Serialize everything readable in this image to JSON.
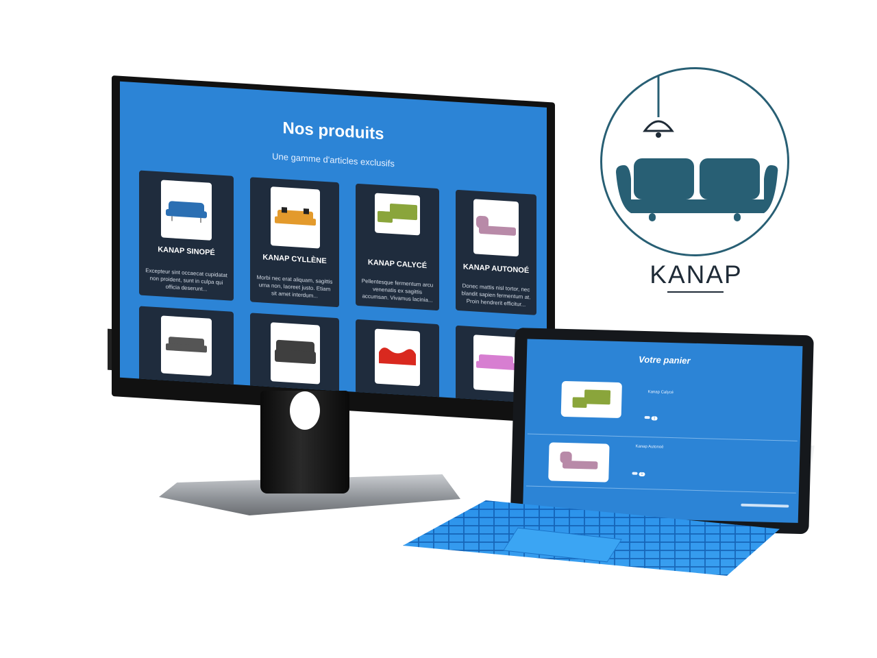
{
  "monitor": {
    "title": "Nos produits",
    "subtitle": "Une gamme d'articles exclusifs",
    "products": [
      {
        "name": "KANAP SINOPÉ",
        "description": "Excepteur sint occaecat cupidatat non proident, sunt in culpa qui officia deserunt...",
        "color": "#2b6fb3"
      },
      {
        "name": "KANAP CYLLÈNE",
        "description": "Morbi nec erat aliquam, sagittis urna non, laoreet justo. Etiam sit amet interdum...",
        "color": "#e39a2c"
      },
      {
        "name": "KANAP CALYCÉ",
        "description": "Pellentesque fermentum arcu venenatis ex sagittis accumsan. Vivamus lacinia...",
        "color": "#8aa53b"
      },
      {
        "name": "KANAP AUTONOÉ",
        "description": "Donec mattis nisl tortor, nec blandit sapien fermentum at. Proin hendrerit efficitur...",
        "color": "#b88aa8"
      },
      {
        "name": "",
        "description": "",
        "color": "#555555"
      },
      {
        "name": "",
        "description": "",
        "color": "#3f3f3f"
      },
      {
        "name": "",
        "description": "",
        "color": "#d9291f"
      },
      {
        "name": "",
        "description": "",
        "color": "#d77ed1"
      }
    ]
  },
  "logo": {
    "text": "KANAP",
    "color": "#285f74"
  },
  "tablet": {
    "title": "Votre panier",
    "items": [
      {
        "name": "Kanap Calycé",
        "color": "#8aa53b"
      },
      {
        "name": "Kanap Autonoé",
        "color": "#b88aa8"
      }
    ]
  }
}
